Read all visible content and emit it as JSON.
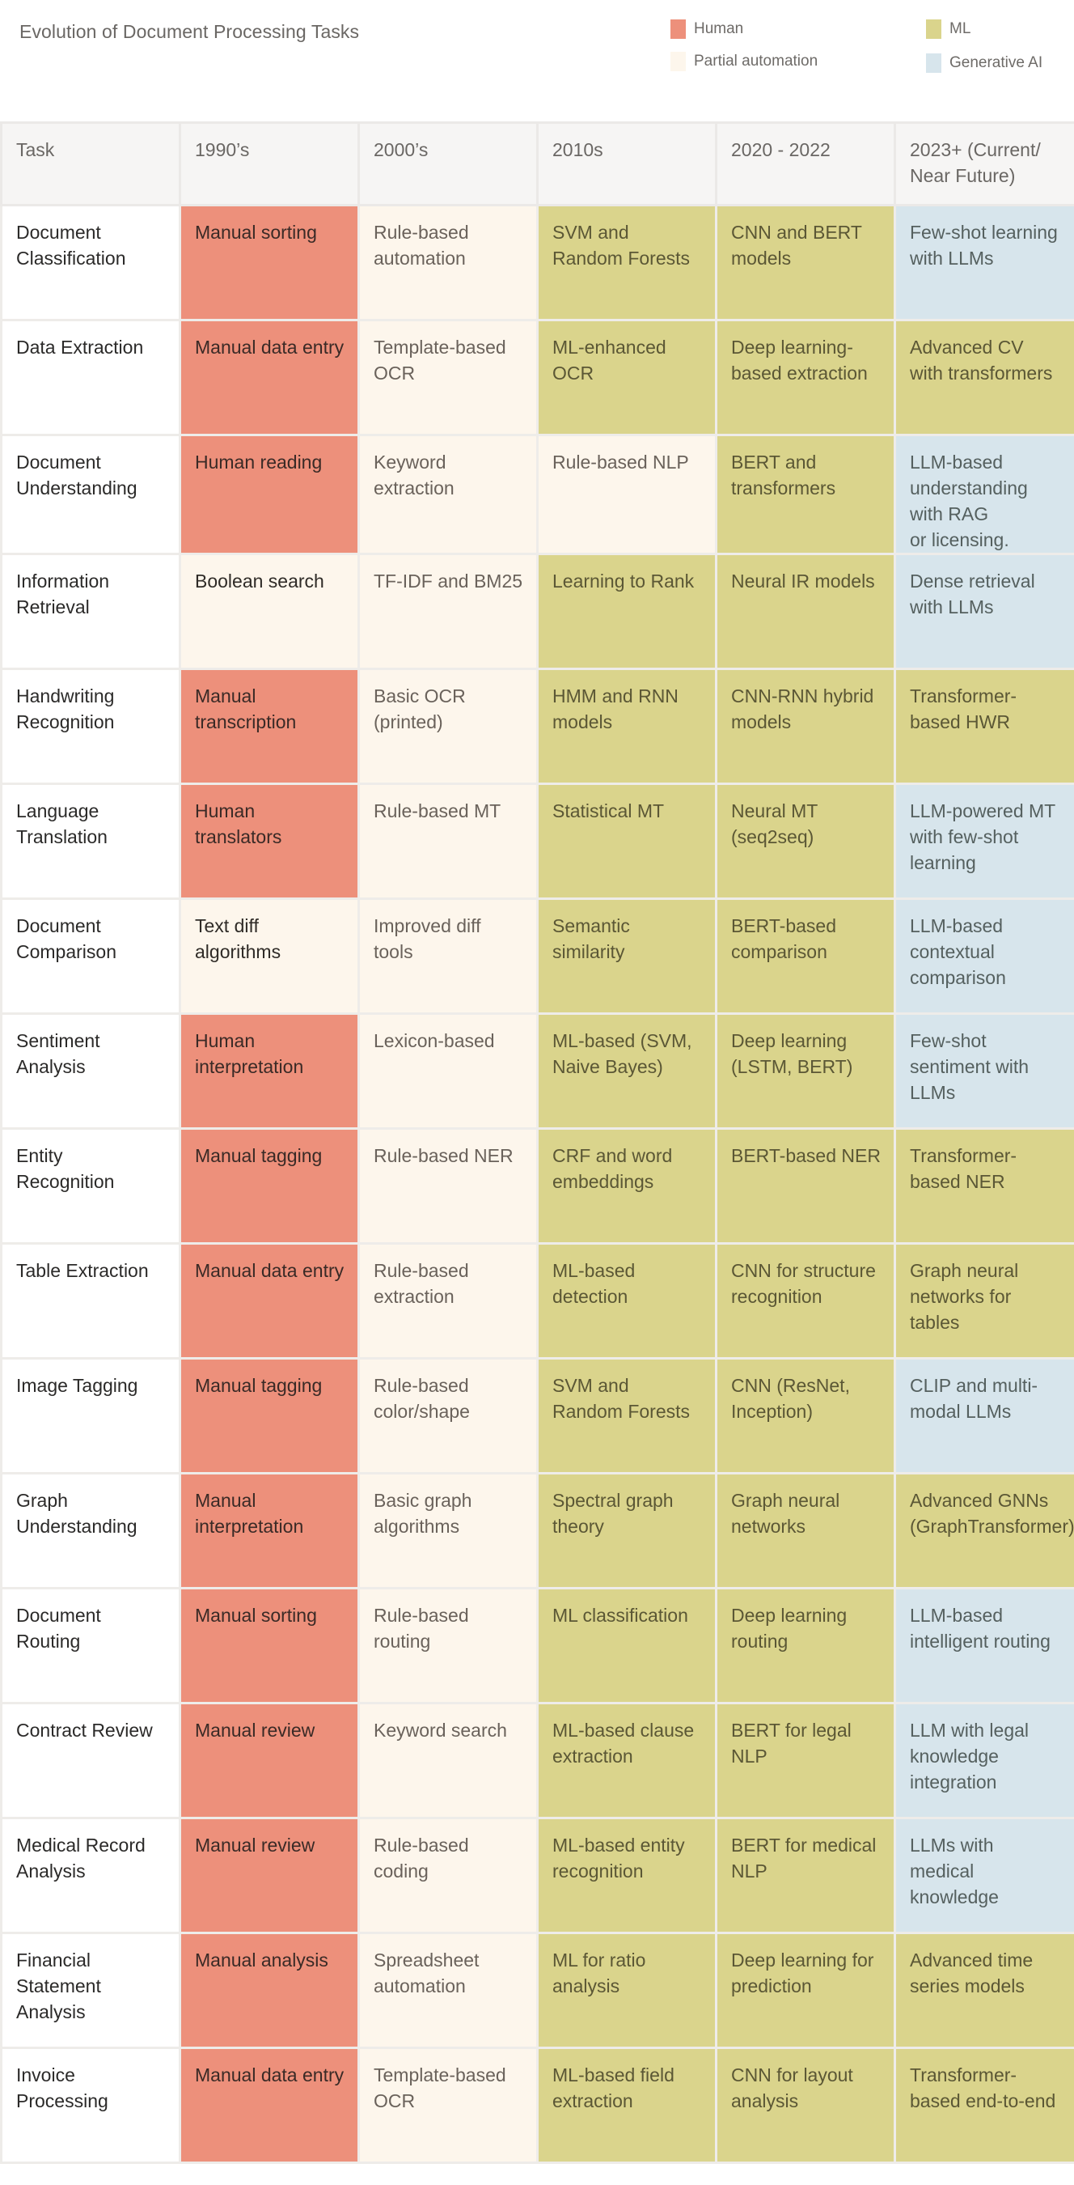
{
  "title": "Evolution of Document Processing Tasks",
  "legend": [
    {
      "key": "human",
      "label": "Human",
      "color": "#ed907b"
    },
    {
      "key": "partial",
      "label": "Partial automation",
      "color": "#fdf6ec"
    },
    {
      "key": "ml",
      "label": "ML",
      "color": "#dad48c"
    },
    {
      "key": "genai",
      "label": "Generative AI",
      "color": "#d7e5ec"
    }
  ],
  "columns": [
    "Task",
    "1990’s",
    "2000’s",
    "2010s",
    "2020 - 2022",
    "2023+ (Current/ Near Future)"
  ],
  "rows": [
    {
      "task": "Document Classification",
      "cells": [
        {
          "text": "Manual sorting",
          "cat": "human"
        },
        {
          "text": "Rule-based automation",
          "cat": "partial"
        },
        {
          "text": "SVM and Random Forests",
          "cat": "ml"
        },
        {
          "text": "CNN and BERT models",
          "cat": "ml"
        },
        {
          "text": "Few-shot learning with LLMs",
          "cat": "genai"
        }
      ]
    },
    {
      "task": "Data Extraction",
      "cells": [
        {
          "text": "Manual data entry",
          "cat": "human"
        },
        {
          "text": "Template-based OCR",
          "cat": "partial"
        },
        {
          "text": "ML-enhanced OCR",
          "cat": "ml"
        },
        {
          "text": "Deep learning-based extraction",
          "cat": "ml"
        },
        {
          "text": "Advanced CV with transformers",
          "cat": "ml"
        }
      ]
    },
    {
      "task": "Document Understanding",
      "cells": [
        {
          "text": "Human reading",
          "cat": "human"
        },
        {
          "text": "Keyword extraction",
          "cat": "partial"
        },
        {
          "text": "Rule-based NLP",
          "cat": "partial"
        },
        {
          "text": "BERT and transformers",
          "cat": "ml"
        },
        {
          "text": "LLM-based understanding with RAG\nor licensing.",
          "cat": "genai"
        }
      ]
    },
    {
      "task": "Information Retrieval",
      "cells": [
        {
          "text": "Boolean search",
          "cat": "partial"
        },
        {
          "text": "TF-IDF and BM25",
          "cat": "partial"
        },
        {
          "text": "Learning to Rank",
          "cat": "ml"
        },
        {
          "text": "Neural IR models",
          "cat": "ml"
        },
        {
          "text": "Dense retrieval with LLMs",
          "cat": "genai"
        }
      ]
    },
    {
      "task": "Handwriting Recognition",
      "cells": [
        {
          "text": "Manual transcription",
          "cat": "human"
        },
        {
          "text": "Basic OCR (printed)",
          "cat": "partial"
        },
        {
          "text": "HMM and RNN models",
          "cat": "ml"
        },
        {
          "text": "CNN-RNN hybrid models",
          "cat": "ml"
        },
        {
          "text": "Transformer-based HWR",
          "cat": "ml"
        }
      ]
    },
    {
      "task": "Language Translation",
      "cells": [
        {
          "text": "Human translators",
          "cat": "human"
        },
        {
          "text": "Rule-based MT",
          "cat": "partial"
        },
        {
          "text": "Statistical MT",
          "cat": "ml"
        },
        {
          "text": "Neural MT (seq2seq)",
          "cat": "ml"
        },
        {
          "text": "LLM-powered MT with few-shot learning",
          "cat": "genai"
        }
      ]
    },
    {
      "task": "Document Comparison",
      "cells": [
        {
          "text": "Text diff algorithms",
          "cat": "partial"
        },
        {
          "text": "Improved diff tools",
          "cat": "partial"
        },
        {
          "text": "Semantic similarity",
          "cat": "ml"
        },
        {
          "text": "BERT-based comparison",
          "cat": "ml"
        },
        {
          "text": "LLM-based contextual comparison",
          "cat": "genai"
        }
      ]
    },
    {
      "task": "Sentiment Analysis",
      "cells": [
        {
          "text": "Human interpretation",
          "cat": "human"
        },
        {
          "text": "Lexicon-based",
          "cat": "partial"
        },
        {
          "text": "ML-based (SVM, Naive Bayes)",
          "cat": "ml"
        },
        {
          "text": "Deep learning (LSTM, BERT)",
          "cat": "ml"
        },
        {
          "text": "Few-shot sentiment with LLMs",
          "cat": "genai"
        }
      ]
    },
    {
      "task": "Entity Recognition",
      "cells": [
        {
          "text": "Manual tagging",
          "cat": "human"
        },
        {
          "text": "Rule-based NER",
          "cat": "partial"
        },
        {
          "text": "CRF and word embeddings",
          "cat": "ml"
        },
        {
          "text": "BERT-based NER",
          "cat": "ml"
        },
        {
          "text": "Transformer-based NER",
          "cat": "ml"
        }
      ]
    },
    {
      "task": "Table Extraction",
      "cells": [
        {
          "text": "Manual data entry",
          "cat": "human"
        },
        {
          "text": "Rule-based extraction",
          "cat": "partial"
        },
        {
          "text": "ML-based detection",
          "cat": "ml"
        },
        {
          "text": "CNN for structure recognition",
          "cat": "ml"
        },
        {
          "text": "Graph neural networks for tables",
          "cat": "ml"
        }
      ]
    },
    {
      "task": "Image Tagging",
      "cells": [
        {
          "text": "Manual tagging",
          "cat": "human"
        },
        {
          "text": "Rule-based color/shape",
          "cat": "partial"
        },
        {
          "text": "SVM and Random Forests",
          "cat": "ml"
        },
        {
          "text": "CNN (ResNet, Inception)",
          "cat": "ml"
        },
        {
          "text": "CLIP and multi-modal LLMs",
          "cat": "genai"
        }
      ]
    },
    {
      "task": "Graph Understanding",
      "cells": [
        {
          "text": "Manual interpretation",
          "cat": "human"
        },
        {
          "text": "Basic graph algorithms",
          "cat": "partial"
        },
        {
          "text": "Spectral graph theory",
          "cat": "ml"
        },
        {
          "text": "Graph neural networks",
          "cat": "ml"
        },
        {
          "text": "Advanced GNNs (GraphTransformer)",
          "cat": "ml"
        }
      ]
    },
    {
      "task": "Document Routing",
      "cells": [
        {
          "text": "Manual sorting",
          "cat": "human"
        },
        {
          "text": "Rule-based routing",
          "cat": "partial"
        },
        {
          "text": "ML classification",
          "cat": "ml"
        },
        {
          "text": "Deep learning routing",
          "cat": "ml"
        },
        {
          "text": "LLM-based intelligent routing",
          "cat": "genai"
        }
      ]
    },
    {
      "task": "Contract Review",
      "cells": [
        {
          "text": "Manual review",
          "cat": "human"
        },
        {
          "text": "Keyword search",
          "cat": "partial"
        },
        {
          "text": "ML-based clause extraction",
          "cat": "ml"
        },
        {
          "text": "BERT for legal NLP",
          "cat": "ml"
        },
        {
          "text": "LLM with legal knowledge integration",
          "cat": "genai"
        }
      ]
    },
    {
      "task": "Medical Record Analysis",
      "cells": [
        {
          "text": "Manual review",
          "cat": "human"
        },
        {
          "text": "Rule-based coding",
          "cat": "partial"
        },
        {
          "text": "ML-based entity recognition",
          "cat": "ml"
        },
        {
          "text": "BERT for medical NLP",
          "cat": "ml"
        },
        {
          "text": "LLMs with medical knowledge",
          "cat": "genai"
        }
      ]
    },
    {
      "task": "Financial Statement Analysis",
      "cells": [
        {
          "text": "Manual analysis",
          "cat": "human"
        },
        {
          "text": "Spreadsheet automation",
          "cat": "partial"
        },
        {
          "text": "ML for ratio analysis",
          "cat": "ml"
        },
        {
          "text": "Deep learning for prediction",
          "cat": "ml"
        },
        {
          "text": "Advanced time series models",
          "cat": "ml"
        }
      ]
    },
    {
      "task": "Invoice Processing",
      "cells": [
        {
          "text": "Manual data entry",
          "cat": "human"
        },
        {
          "text": "Template-based OCR",
          "cat": "partial"
        },
        {
          "text": "ML-based field extraction",
          "cat": "ml"
        },
        {
          "text": "CNN for layout analysis",
          "cat": "ml"
        },
        {
          "text": "Transformer-based end-to-end",
          "cat": "ml"
        }
      ]
    }
  ]
}
